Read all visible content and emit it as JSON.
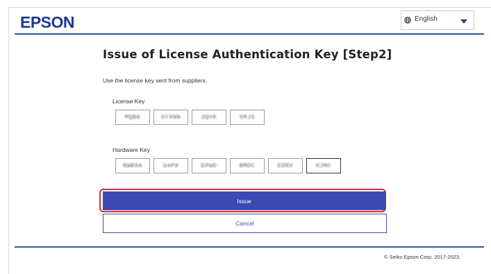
{
  "header": {
    "logo": "EPSON",
    "language": {
      "icon": "globe-icon",
      "selected": "English"
    }
  },
  "main": {
    "title": "Issue of License Authentication Key [Step2]",
    "intro": "Use the license key sent from suppliers.",
    "license_key": {
      "label": "License Key",
      "fields": [
        "MQB6",
        "5Y4NN",
        "2QVK",
        "5MJ5"
      ]
    },
    "hardware_key": {
      "label": "Hardware Key",
      "fields": [
        "NWB9A",
        "U4P8",
        "EPWD",
        "BMDC",
        "EDRX",
        "HJMC"
      ],
      "active_index": 5
    },
    "issue_label": "Issue",
    "cancel_label": "Cancel"
  },
  "footer": {
    "copyright": "© Seiko Epson Corp. 2017-2023."
  },
  "colors": {
    "brand": "#1d3a93",
    "primary_button": "#3e4ab3",
    "highlight": "#d32f2f"
  }
}
